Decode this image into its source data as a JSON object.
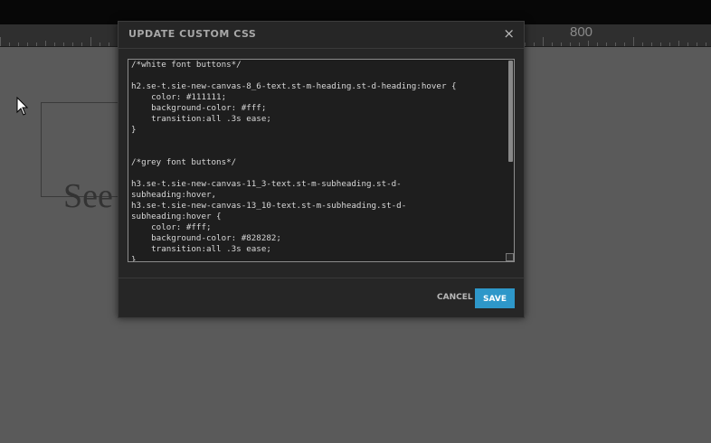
{
  "ruler": {
    "label": "800"
  },
  "canvas": {
    "text": "See"
  },
  "modal": {
    "title": "UPDATE CUSTOM CSS",
    "close_label": "×",
    "code": "/*white font buttons*/\n\nh2.se-t.sie-new-canvas-8_6-text.st-m-heading.st-d-heading:hover {\n    color: #111111;\n    background-color: #fff;\n    transition:all .3s ease;\n}\n\n\n/*grey font buttons*/\n\nh3.se-t.sie-new-canvas-11_3-text.st-m-subheading.st-d-\nsubheading:hover,\nh3.se-t.sie-new-canvas-13_10-text.st-m-subheading.st-d-\nsubheading:hover {\n    color: #fff;\n    background-color: #828282;\n    transition:all .3s ease;\n}",
    "cancel_label": "CANCEL",
    "save_label": "SAVE"
  }
}
